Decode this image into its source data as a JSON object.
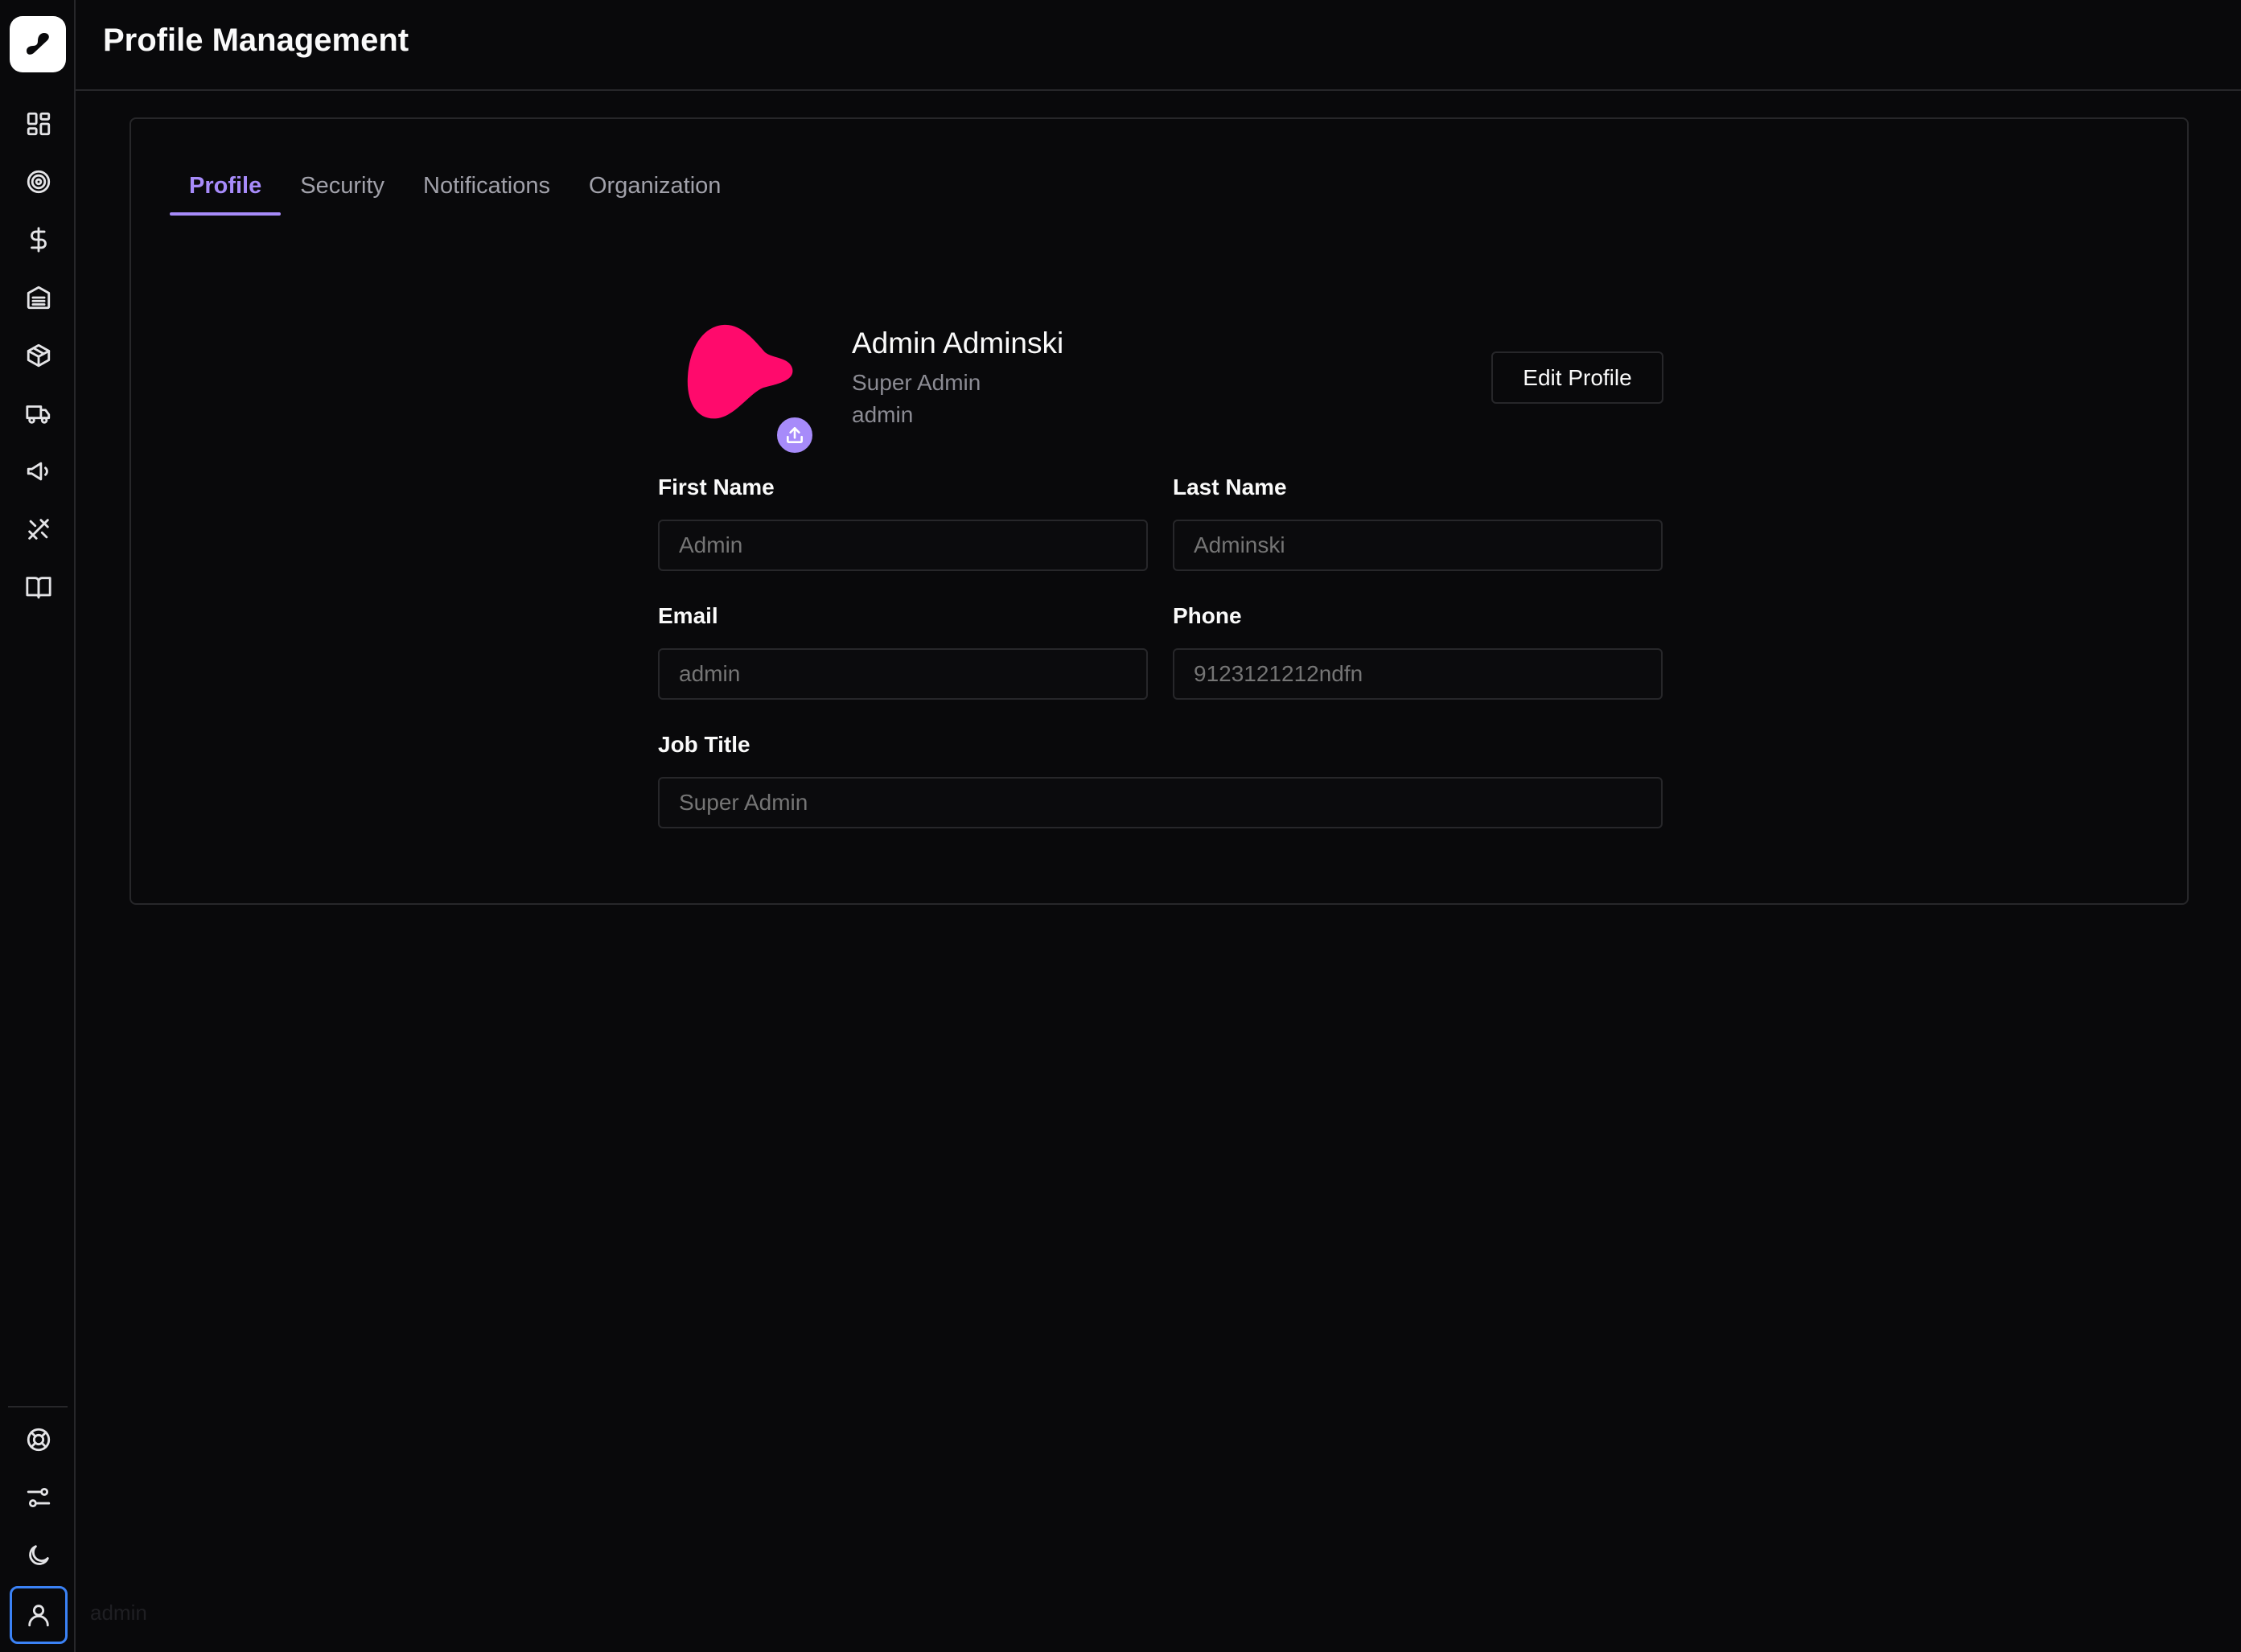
{
  "app": {
    "logo_icon": "brand-logo-icon"
  },
  "header": {
    "title": "Profile Management"
  },
  "sidebar": {
    "items": [
      {
        "name": "dashboard",
        "icon": "grid-icon"
      },
      {
        "name": "goals",
        "icon": "target-icon"
      },
      {
        "name": "finance",
        "icon": "dollar-icon"
      },
      {
        "name": "warehouse",
        "icon": "warehouse-icon"
      },
      {
        "name": "products",
        "icon": "package-icon"
      },
      {
        "name": "shipping",
        "icon": "truck-icon"
      },
      {
        "name": "marketing",
        "icon": "megaphone-icon"
      },
      {
        "name": "tools",
        "icon": "tools-icon"
      },
      {
        "name": "docs",
        "icon": "book-icon"
      }
    ],
    "bottom_items": [
      {
        "name": "support",
        "icon": "lifebuoy-icon"
      },
      {
        "name": "settings",
        "icon": "sliders-icon"
      },
      {
        "name": "theme",
        "icon": "moon-icon"
      },
      {
        "name": "user",
        "icon": "user-icon"
      }
    ],
    "user_label": "admin"
  },
  "tabs": [
    {
      "label": "Profile",
      "active": true
    },
    {
      "label": "Security",
      "active": false
    },
    {
      "label": "Notifications",
      "active": false
    },
    {
      "label": "Organization",
      "active": false
    }
  ],
  "profile": {
    "full_name": "Admin Adminski",
    "role": "Super Admin",
    "username": "admin",
    "avatar_color": "#ff0a6c",
    "edit_label": "Edit Profile"
  },
  "form": {
    "first_name": {
      "label": "First Name",
      "placeholder": "Admin"
    },
    "last_name": {
      "label": "Last Name",
      "placeholder": "Adminski"
    },
    "email": {
      "label": "Email",
      "placeholder": "admin"
    },
    "phone": {
      "label": "Phone",
      "placeholder": "9123121212ndfn"
    },
    "job_title": {
      "label": "Job Title",
      "placeholder": "Super Admin"
    }
  },
  "colors": {
    "accent": "#a78bfa",
    "background": "#09090b",
    "border": "#27272a",
    "focus_ring": "#3b82f6"
  }
}
